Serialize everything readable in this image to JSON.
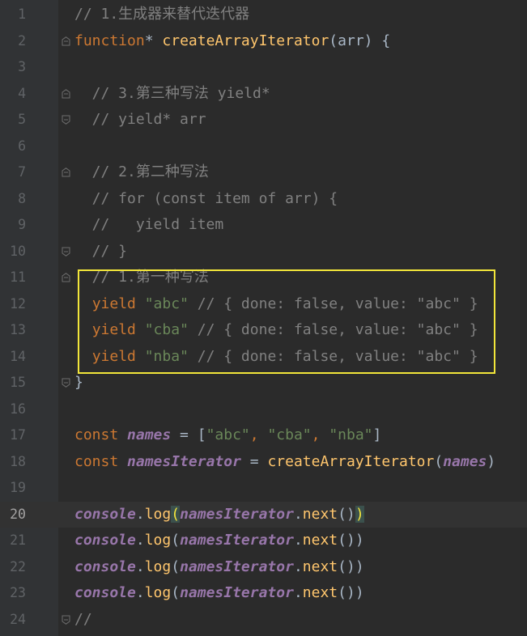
{
  "editor": {
    "current_line": "20",
    "lines": [
      {
        "num": "1",
        "parts": [
          {
            "t": "cm",
            "v": "// 1.生成器来替代迭代器"
          }
        ]
      },
      {
        "num": "2",
        "parts": [
          {
            "t": "kw",
            "v": "function"
          },
          {
            "t": "plain",
            "v": "* "
          },
          {
            "t": "fn",
            "v": "createArrayIterator"
          },
          {
            "t": "plain",
            "v": "("
          },
          {
            "t": "param",
            "v": "arr"
          },
          {
            "t": "plain",
            "v": ") {"
          }
        ]
      },
      {
        "num": "3",
        "parts": []
      },
      {
        "num": "4",
        "parts": [
          {
            "t": "cm",
            "v": "  // 3.第三种写法 yield*"
          }
        ]
      },
      {
        "num": "5",
        "parts": [
          {
            "t": "cm",
            "v": "  // yield* arr"
          }
        ]
      },
      {
        "num": "6",
        "parts": []
      },
      {
        "num": "7",
        "parts": [
          {
            "t": "cm",
            "v": "  // 2.第二种写法"
          }
        ]
      },
      {
        "num": "8",
        "parts": [
          {
            "t": "cm",
            "v": "  // for (const item of arr) {"
          }
        ]
      },
      {
        "num": "9",
        "parts": [
          {
            "t": "cm",
            "v": "  //   yield item"
          }
        ]
      },
      {
        "num": "10",
        "parts": [
          {
            "t": "cm",
            "v": "  // }"
          }
        ]
      },
      {
        "num": "11",
        "parts": [
          {
            "t": "cm",
            "v": "  // 1.第一种写法"
          }
        ]
      },
      {
        "num": "12",
        "parts": [
          {
            "t": "plain",
            "v": "  "
          },
          {
            "t": "kw",
            "v": "yield "
          },
          {
            "t": "str",
            "v": "\"abc\""
          },
          {
            "t": "cm",
            "v": " // { done: false, value: \"abc\" }"
          }
        ]
      },
      {
        "num": "13",
        "parts": [
          {
            "t": "plain",
            "v": "  "
          },
          {
            "t": "kw",
            "v": "yield "
          },
          {
            "t": "str",
            "v": "\"cba\""
          },
          {
            "t": "cm",
            "v": " // { done: false, value: \"abc\" }"
          }
        ]
      },
      {
        "num": "14",
        "parts": [
          {
            "t": "plain",
            "v": "  "
          },
          {
            "t": "kw",
            "v": "yield "
          },
          {
            "t": "str",
            "v": "\"nba\""
          },
          {
            "t": "cm",
            "v": " // { done: false, value: \"abc\" }"
          }
        ]
      },
      {
        "num": "15",
        "parts": [
          {
            "t": "plain",
            "v": "}"
          }
        ]
      },
      {
        "num": "16",
        "parts": []
      },
      {
        "num": "17",
        "parts": [
          {
            "t": "kw",
            "v": "const "
          },
          {
            "t": "glob",
            "v": "names"
          },
          {
            "t": "plain",
            "v": " = ["
          },
          {
            "t": "str",
            "v": "\"abc\""
          },
          {
            "t": "kw",
            "v": ", "
          },
          {
            "t": "str",
            "v": "\"cba\""
          },
          {
            "t": "kw",
            "v": ", "
          },
          {
            "t": "str",
            "v": "\"nba\""
          },
          {
            "t": "plain",
            "v": "]"
          }
        ]
      },
      {
        "num": "18",
        "parts": [
          {
            "t": "kw",
            "v": "const "
          },
          {
            "t": "glob",
            "v": "namesIterator"
          },
          {
            "t": "plain",
            "v": " = "
          },
          {
            "t": "fn",
            "v": "createArrayIterator"
          },
          {
            "t": "plain",
            "v": "("
          },
          {
            "t": "glob",
            "v": "names"
          },
          {
            "t": "plain",
            "v": ")"
          }
        ]
      },
      {
        "num": "19",
        "parts": []
      },
      {
        "num": "20",
        "parts": [
          {
            "t": "glob",
            "v": "console"
          },
          {
            "t": "plain",
            "v": "."
          },
          {
            "t": "fn",
            "v": "log"
          },
          {
            "t": "bracehl",
            "v": "("
          },
          {
            "t": "glob",
            "v": "namesIterator"
          },
          {
            "t": "plain",
            "v": "."
          },
          {
            "t": "fn",
            "v": "next"
          },
          {
            "t": "plain",
            "v": "()"
          },
          {
            "t": "bracehl",
            "v": ")"
          }
        ]
      },
      {
        "num": "21",
        "parts": [
          {
            "t": "glob",
            "v": "console"
          },
          {
            "t": "plain",
            "v": "."
          },
          {
            "t": "fn",
            "v": "log"
          },
          {
            "t": "plain",
            "v": "("
          },
          {
            "t": "glob",
            "v": "namesIterator"
          },
          {
            "t": "plain",
            "v": "."
          },
          {
            "t": "fn",
            "v": "next"
          },
          {
            "t": "plain",
            "v": "())"
          }
        ]
      },
      {
        "num": "22",
        "parts": [
          {
            "t": "glob",
            "v": "console"
          },
          {
            "t": "plain",
            "v": "."
          },
          {
            "t": "fn",
            "v": "log"
          },
          {
            "t": "plain",
            "v": "("
          },
          {
            "t": "glob",
            "v": "namesIterator"
          },
          {
            "t": "plain",
            "v": "."
          },
          {
            "t": "fn",
            "v": "next"
          },
          {
            "t": "plain",
            "v": "())"
          }
        ]
      },
      {
        "num": "23",
        "parts": [
          {
            "t": "glob",
            "v": "console"
          },
          {
            "t": "plain",
            "v": "."
          },
          {
            "t": "fn",
            "v": "log"
          },
          {
            "t": "plain",
            "v": "("
          },
          {
            "t": "glob",
            "v": "namesIterator"
          },
          {
            "t": "plain",
            "v": "."
          },
          {
            "t": "fn",
            "v": "next"
          },
          {
            "t": "plain",
            "v": "())"
          }
        ]
      },
      {
        "num": "24",
        "parts": [
          {
            "t": "cm",
            "v": "//"
          }
        ]
      }
    ],
    "fold_markers": [
      "2",
      "4",
      "5",
      "7",
      "10",
      "11",
      "15",
      "24"
    ],
    "colors": {
      "background": "#2b2b2b",
      "gutter": "#313335",
      "keyword": "#cc7832",
      "function": "#ffc66d",
      "string": "#6a8759",
      "comment": "#808080",
      "global": "#9876aa",
      "highlight_box": "#f2e63a"
    }
  }
}
